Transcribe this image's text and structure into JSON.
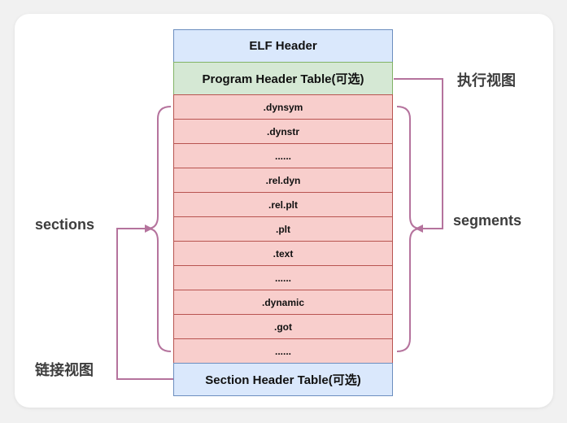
{
  "diagram": {
    "elf_header": "ELF Header",
    "program_header_table": "Program Header Table(可选)",
    "section_header_table": "Section Header Table(可选)",
    "sections": [
      ".dynsym",
      ".dynstr",
      "......",
      ".rel.dyn",
      ".rel.plt",
      ".plt",
      ".text",
      "......",
      ".dynamic",
      ".got",
      "......"
    ],
    "labels": {
      "execution_view": "执行视图",
      "segments": "segments",
      "sections": "sections",
      "linking_view": "链接视图"
    }
  },
  "colors": {
    "header_fill": "#dae8fc",
    "header_border": "#6c8ebf",
    "pht_fill": "#d5e8d4",
    "pht_border": "#82b366",
    "section_fill": "#f8cecc",
    "section_border": "#b85450",
    "connector": "#b5739d"
  }
}
